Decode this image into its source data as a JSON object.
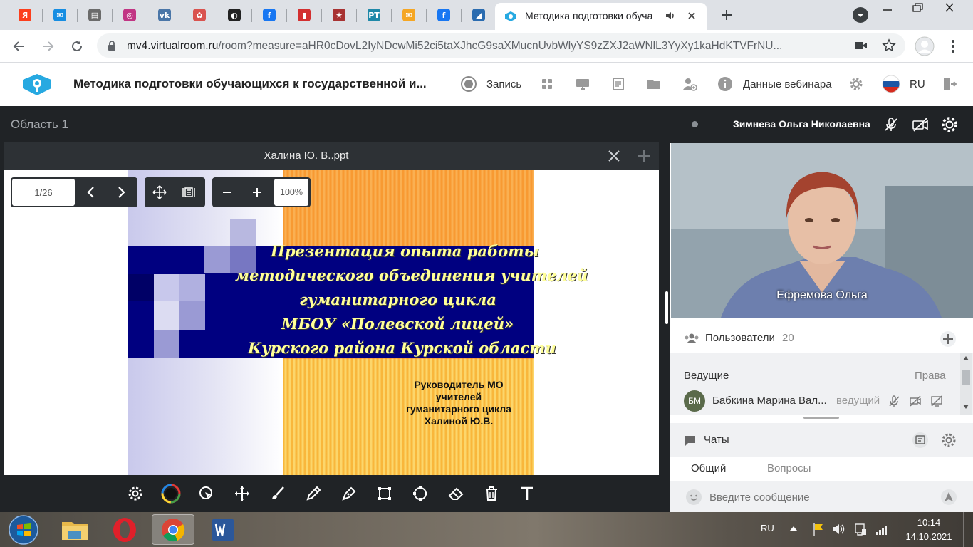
{
  "browser": {
    "active_tab": {
      "title": "Методика подготовки обуча",
      "icon": "virtualroom-logo-icon"
    },
    "pinned_tabs": [
      {
        "icon": "yandex-icon",
        "glyph": "Я",
        "color": "#fc3f1d"
      },
      {
        "icon": "mail-icon",
        "glyph": "✉",
        "color": "#168de2"
      },
      {
        "icon": "document-icon",
        "glyph": "▤",
        "color": "#6b6b6b"
      },
      {
        "icon": "instagram-icon",
        "glyph": "◎",
        "color": "#c13584"
      },
      {
        "icon": "vk-icon",
        "glyph": "vk",
        "color": "#4a76a8"
      },
      {
        "icon": "flower-icon",
        "glyph": "✿",
        "color": "#d9534f"
      },
      {
        "icon": "game-icon",
        "glyph": "◐",
        "color": "#222222"
      },
      {
        "icon": "facebook-icon",
        "glyph": "f",
        "color": "#1877f2"
      },
      {
        "icon": "reader-icon",
        "glyph": "▮",
        "color": "#d32f2f"
      },
      {
        "icon": "star-icon",
        "glyph": "★",
        "color": "#a83232"
      },
      {
        "icon": "rt-icon",
        "glyph": "PT",
        "color": "#1e88a8"
      },
      {
        "icon": "envelope-icon",
        "glyph": "✉",
        "color": "#f5a623"
      },
      {
        "icon": "facebook-icon",
        "glyph": "f",
        "color": "#1877f2"
      },
      {
        "icon": "chart-icon",
        "glyph": "◢",
        "color": "#2b6cb0"
      }
    ],
    "url_host": "mv4.virtualroom.ru",
    "url_rest": "/room?measure=aHR0cDovL2IyNDcwMi52ci5taXJhcG9saXMucnUvbWlyYS9zZXJ2aWNlL3YyXy1kaHdKTVFrNU..."
  },
  "app": {
    "title": "Методика подготовки обучающихся к государственной и...",
    "record_label": "Запись",
    "webinar_data_label": "Данные вебинара",
    "language": "RU"
  },
  "workspace": {
    "area_title": "Область 1",
    "doc_name": "Халина Ю. В..ppt",
    "page": "1/26",
    "zoom": "100%",
    "slide": {
      "title_lines": [
        "Презентация опыта работы",
        "методического объединения  учителей",
        "гуманитарного цикла",
        "МБОУ «Полевской лицей»",
        "Курского района  Курской области"
      ],
      "subtitle_lines": [
        "Руководитель МО",
        "учителей",
        "гуманитарного цикла",
        "Халиной Ю.В."
      ]
    }
  },
  "panel": {
    "presenter_name": "Зимнева Ольга Николаевна",
    "camera_label": "Ефремова Ольга",
    "users_title": "Пользователи",
    "users_count": "20",
    "hosts_label": "Ведущие",
    "rights_label": "Права",
    "host": {
      "initials": "БМ",
      "name": "Бабкина Марина Вал...",
      "role": "ведущий"
    },
    "chats_title": "Чаты",
    "chat_tabs": [
      "Общий",
      "Вопросы"
    ],
    "message_placeholder": "Введите сообщение"
  },
  "taskbar": {
    "lang": "RU",
    "time": "10:14",
    "date": "14.10.2021"
  },
  "colors": {
    "slide_navy": "#000080",
    "slide_orange": "#f7942a",
    "slide_yellow_text": "#ffff99",
    "dark_bg": "#202326"
  }
}
